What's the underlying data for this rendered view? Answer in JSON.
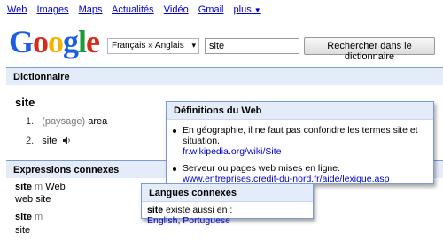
{
  "nav": {
    "links": [
      "Web",
      "Images",
      "Maps",
      "Actualités",
      "Vidéo",
      "Gmail",
      "plus"
    ]
  },
  "logo": {
    "letters": [
      "G",
      "o",
      "o",
      "g",
      "l",
      "e"
    ]
  },
  "search": {
    "language": "Français » Anglais",
    "query": "site",
    "button": "Rechercher dans le dictionnaire"
  },
  "dictionary": {
    "header": "Dictionnaire",
    "word": "site",
    "entries": [
      {
        "num": "1.",
        "note": "(paysage)",
        "text": "area"
      },
      {
        "num": "2.",
        "text": "site"
      }
    ]
  },
  "related": {
    "header": "Expressions connexes",
    "items": [
      {
        "word": "site",
        "gender": "m",
        "translation": "Web",
        "sub": "web site"
      },
      {
        "word": "site",
        "gender": "m",
        "sub": "site"
      }
    ]
  },
  "web_defs": {
    "header": "Définitions du Web",
    "items": [
      {
        "text": "En géographie, il ne faut pas confondre les termes site et situation.",
        "link": "fr.wikipedia.org/wiki/Site"
      },
      {
        "text": "Serveur ou pages web mises en ligne.",
        "link": "www.entreprises.credit-du-nord.fr/aide/lexique.asp"
      }
    ]
  },
  "langues": {
    "header": "Langues connexes",
    "word": "site",
    "text": " existe aussi en : ",
    "links": [
      "English",
      "Portuguese"
    ],
    "sep": ","
  }
}
